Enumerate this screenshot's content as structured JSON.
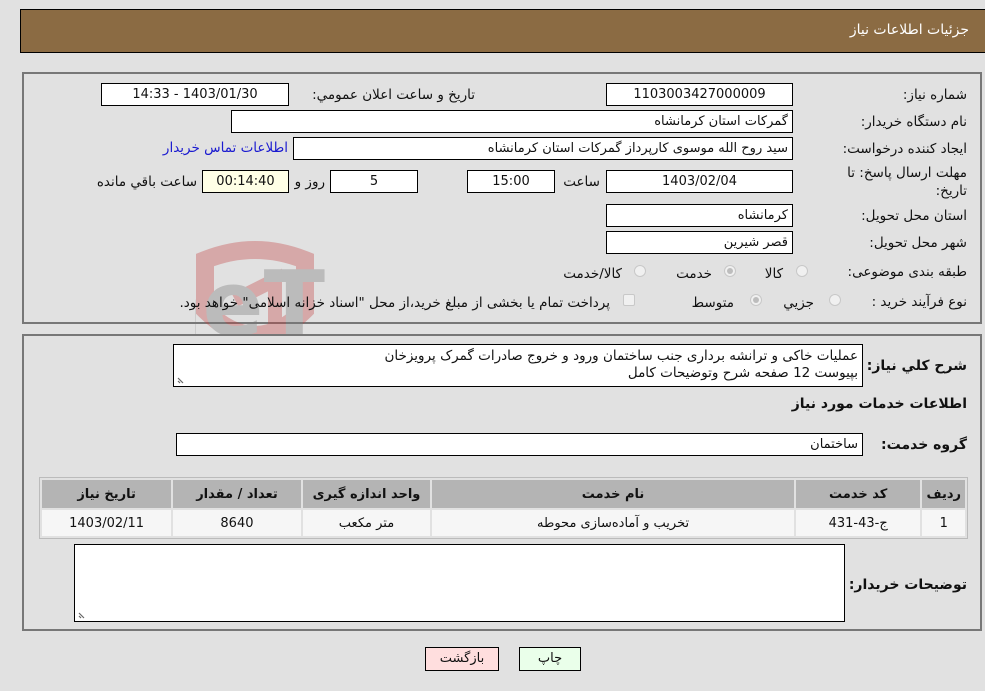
{
  "header": {
    "title": "جزئيات اطلاعات نیاز"
  },
  "form": {
    "need_number": {
      "label": "شماره نیاز:",
      "value": "1103003427000009"
    },
    "announce_datetime": {
      "label": "تاريخ و ساعت اعلان عمومي:",
      "value": "1403/01/30 - 14:33"
    },
    "buyer_org": {
      "label": "نام دستگاه خریدار:",
      "value": "گمرکات استان کرمانشاه"
    },
    "requester": {
      "label": "ایجاد کننده درخواست:",
      "value": "سید روح الله موسوی کارپرداز گمرکات استان کرمانشاه"
    },
    "buyer_contact_link": "اطلاعات تماس خریدار",
    "deadline": {
      "label": "مهلت ارسال پاسخ: تا تاریخ:",
      "date": "1403/02/04",
      "time_label": "ساعت",
      "time": "15:00",
      "days": "5",
      "days_label": "روز و",
      "remaining": "00:14:40",
      "remaining_label": "ساعت باقي مانده"
    },
    "delivery_province": {
      "label": "استان محل تحویل:",
      "value": "کرمانشاه"
    },
    "delivery_city": {
      "label": "شهر محل تحویل:",
      "value": "قصر شیرین"
    },
    "category": {
      "label": "طبقه بندی موضوعی:",
      "options": [
        "کالا",
        "خدمت",
        "کالا/خدمت"
      ],
      "selected": "خدمت"
    },
    "purchase_type": {
      "label": "نوع فرآیند خرید :",
      "options": [
        "جزيي",
        "متوسط"
      ],
      "selected": "متوسط",
      "treasury_note": "پرداخت تمام یا بخشی از مبلغ خرید،از محل \"اسناد خزانه اسلامی\" خواهد بود."
    }
  },
  "details": {
    "description_label": "شرح کلي نياز:",
    "description_lines": [
      "عملیات خاکی و ترانشه برداری جنب ساختمان ورود و خروج صادرات گمرک پرویزخان",
      "بپیوست 12 صفحه شرح وتوضیحات کامل"
    ],
    "services_heading": "اطلاعات خدمات مورد نیاز",
    "service_group_label": "گروه خدمت:",
    "service_group_value": "ساختمان",
    "table": {
      "headers": [
        "ردیف",
        "کد خدمت",
        "نام خدمت",
        "واحد اندازه گیری",
        "تعداد / مقدار",
        "تاریخ نیاز"
      ],
      "rows": [
        [
          "1",
          "ج-43-431",
          "تخریب و آماده‌سازی محوطه",
          "متر مکعب",
          "8640",
          "1403/02/11"
        ]
      ]
    },
    "buyer_notes_label": "توضیحات خریدار:",
    "buyer_notes_value": ""
  },
  "buttons": {
    "print": "چاپ",
    "back": "بازگشت"
  },
  "colors": {
    "header_bg": "#8b6b43",
    "print_bg": "#eaffea",
    "back_bg": "#ffdede",
    "link": "#1a1ad0"
  }
}
